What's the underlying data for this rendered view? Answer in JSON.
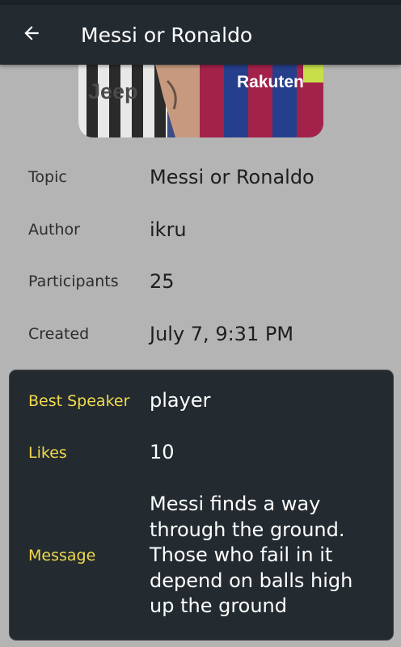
{
  "appbar": {
    "title": "Messi or Ronaldo",
    "back_icon": "arrow-left-icon"
  },
  "banner": {
    "sponsor_left": "Jeep",
    "sponsor_right": "Rakuten"
  },
  "details": [
    {
      "label": "Topic",
      "value": "Messi or Ronaldo"
    },
    {
      "label": "Author",
      "value": "ikru"
    },
    {
      "label": "Participants",
      "value": "25"
    },
    {
      "label": "Created",
      "value": "July 7, 9:31 PM"
    }
  ],
  "best_speaker_card": {
    "speaker_label": "Best Speaker",
    "speaker_value": "player",
    "likes_label": "Likes",
    "likes_value": "10",
    "message_label": "Message",
    "message_lines": [
      "Messi finds a way",
      "through the ground.",
      "Those who fail in it",
      "depend on balls high",
      "up the ground"
    ]
  },
  "colors": {
    "appbar": "#232b30",
    "page_background": "#b4b4b4",
    "card_background": "#232b30",
    "card_label": "#f2d94e"
  }
}
